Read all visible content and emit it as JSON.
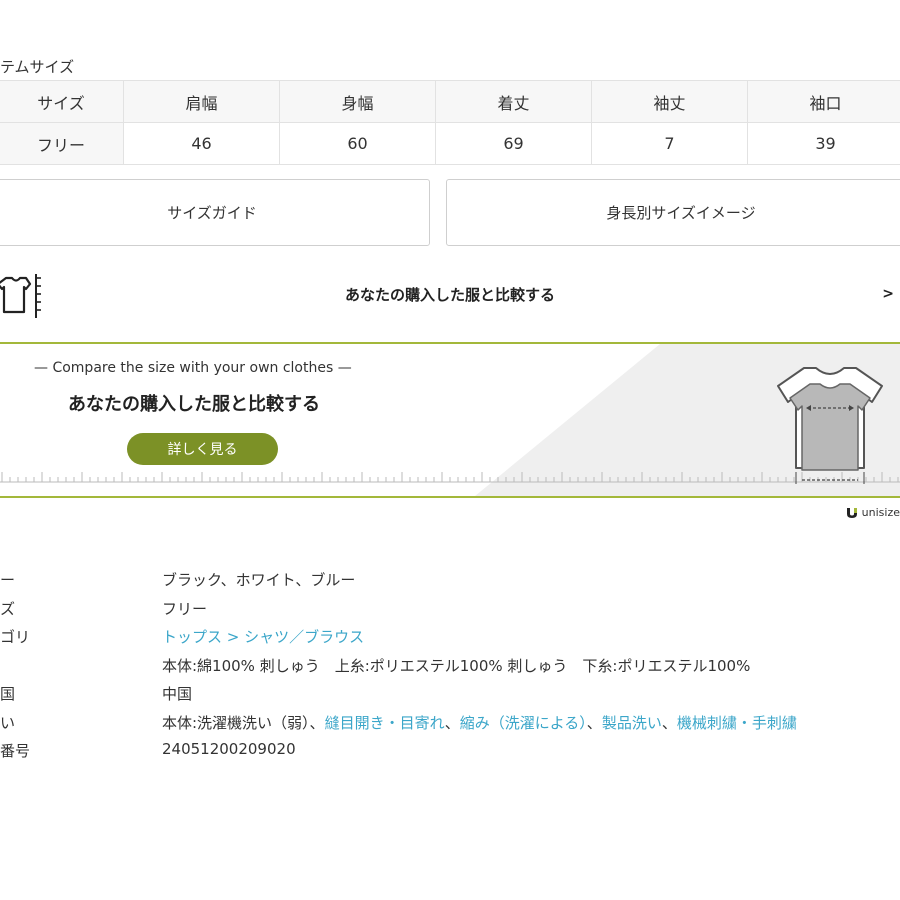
{
  "section_title": "テムサイズ",
  "size_table": {
    "headers": [
      "サイズ",
      "肩幅",
      "身幅",
      "着丈",
      "袖丈",
      "袖口"
    ],
    "row": [
      "フリー",
      "46",
      "60",
      "69",
      "7",
      "39"
    ]
  },
  "buttons": {
    "size_guide": "サイズガイド",
    "height_image": "身長別サイズイメージ"
  },
  "compare_row": {
    "label": "あなたの購入した服と比較する",
    "chevron": ">"
  },
  "banner": {
    "english": "— Compare the size with your own clothes —",
    "japanese": "あなたの購入した服と比較する",
    "button": "詳しく見る",
    "accent_color": "#7c9126",
    "line_color": "#a3b83a"
  },
  "brand": "unisize",
  "specs": [
    {
      "key": "ー",
      "value": "ブラック、ホワイト、ブルー"
    },
    {
      "key": "ズ",
      "value": "フリー"
    },
    {
      "key": "ゴリ",
      "value_link_1": "トップス",
      "value_sep": " > ",
      "value_link_2": "シャツ／ブラウス"
    },
    {
      "key": "",
      "value": "本体:綿100% 刺しゅう　上糸:ポリエステル100% 刺しゅう　下糸:ポリエステル100%"
    },
    {
      "key": "国",
      "value": "中国"
    },
    {
      "key": "い",
      "value_prefix": "本体:洗濯機洗い（弱）、",
      "value_link_1": "縫目開き・目寄れ",
      "value_sep": "、",
      "value_link_2": "縮み（洗濯による）",
      "value_sep2": "、",
      "value_link_3": "製品洗い",
      "value_sep3": "、",
      "value_link_4": "機械刺繍・手刺繍"
    },
    {
      "key": "番号",
      "value": "24051200209020"
    }
  ],
  "icons": [
    "shirt-ruler-icon",
    "shirt-compare-illustration",
    "unisize-logo-icon",
    "chevron-right-icon"
  ]
}
